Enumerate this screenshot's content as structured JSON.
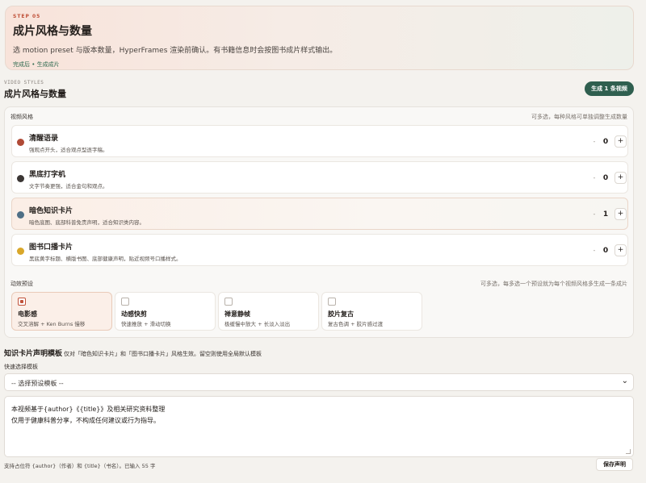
{
  "hero": {
    "step": "STEP 05",
    "title": "成片风格与数量",
    "description": "选 motion preset 与版本数量，HyperFrames 渲染前确认。有书籍信息时会按图书成片样式输出。",
    "after": "完成后 • 生成成片"
  },
  "section": {
    "eyebrow": "VIDEO STYLES",
    "title": "成片风格与数量",
    "generate_button": "生成 1 条视频"
  },
  "styles": {
    "label": "视频风格",
    "hint": "可多选，每种风格可单独调整生成数量",
    "items": [
      {
        "name": "清醒语录",
        "desc": "强观点开头，适合观点型逐字稿。",
        "count": "0",
        "dot_color": "#b04a36",
        "selected": false
      },
      {
        "name": "黑底打字机",
        "desc": "文字节奏更强，适合金句和观点。",
        "count": "0",
        "dot_color": "#3b3634",
        "selected": false
      },
      {
        "name": "暗色知识卡片",
        "desc": "暗色底图、底部科普免责声明，适合知识类内容。",
        "count": "1",
        "dot_color": "#4f6f86",
        "selected": true
      },
      {
        "name": "图书口播卡片",
        "desc": "黑底黄字标题、横版书图、底部健康声明，贴近视频号口播样式。",
        "count": "0",
        "dot_color": "#d9a72a",
        "selected": false
      }
    ],
    "minus": "-",
    "plus": "+"
  },
  "motion": {
    "label": "动效预设",
    "hint": "可多选，每多选一个预设就为每个视频风格多生成一条成片",
    "items": [
      {
        "name": "电影感",
        "desc": "交叉溶解 + Ken Burns 慢移",
        "selected": true
      },
      {
        "name": "动感快剪",
        "desc": "快速推放 + 滑动切换",
        "selected": false
      },
      {
        "name": "禅意静帧",
        "desc": "极缓慢中放大 + 长淡入淡出",
        "selected": false
      },
      {
        "name": "胶片复古",
        "desc": "复古色调 + 胶片感过渡",
        "selected": false
      }
    ]
  },
  "declaration": {
    "title": "知识卡片声明模板",
    "note": "仅对「暗色知识卡片」和「图书口播卡片」风格生效。留空则使用全局默认模板",
    "quick_label": "快速选择模板",
    "select_value": "-- 选择预设模板 --",
    "text_lines": [
      "本视频基于{author}《{title}》及相关研究资料整理",
      "仅用于健康科普分享，不构成任何建议或行为指导。"
    ],
    "footer": "支持占位符 {author}（作者）和 {title}（书名）。已输入 55 字",
    "save_button": "保存声明"
  }
}
